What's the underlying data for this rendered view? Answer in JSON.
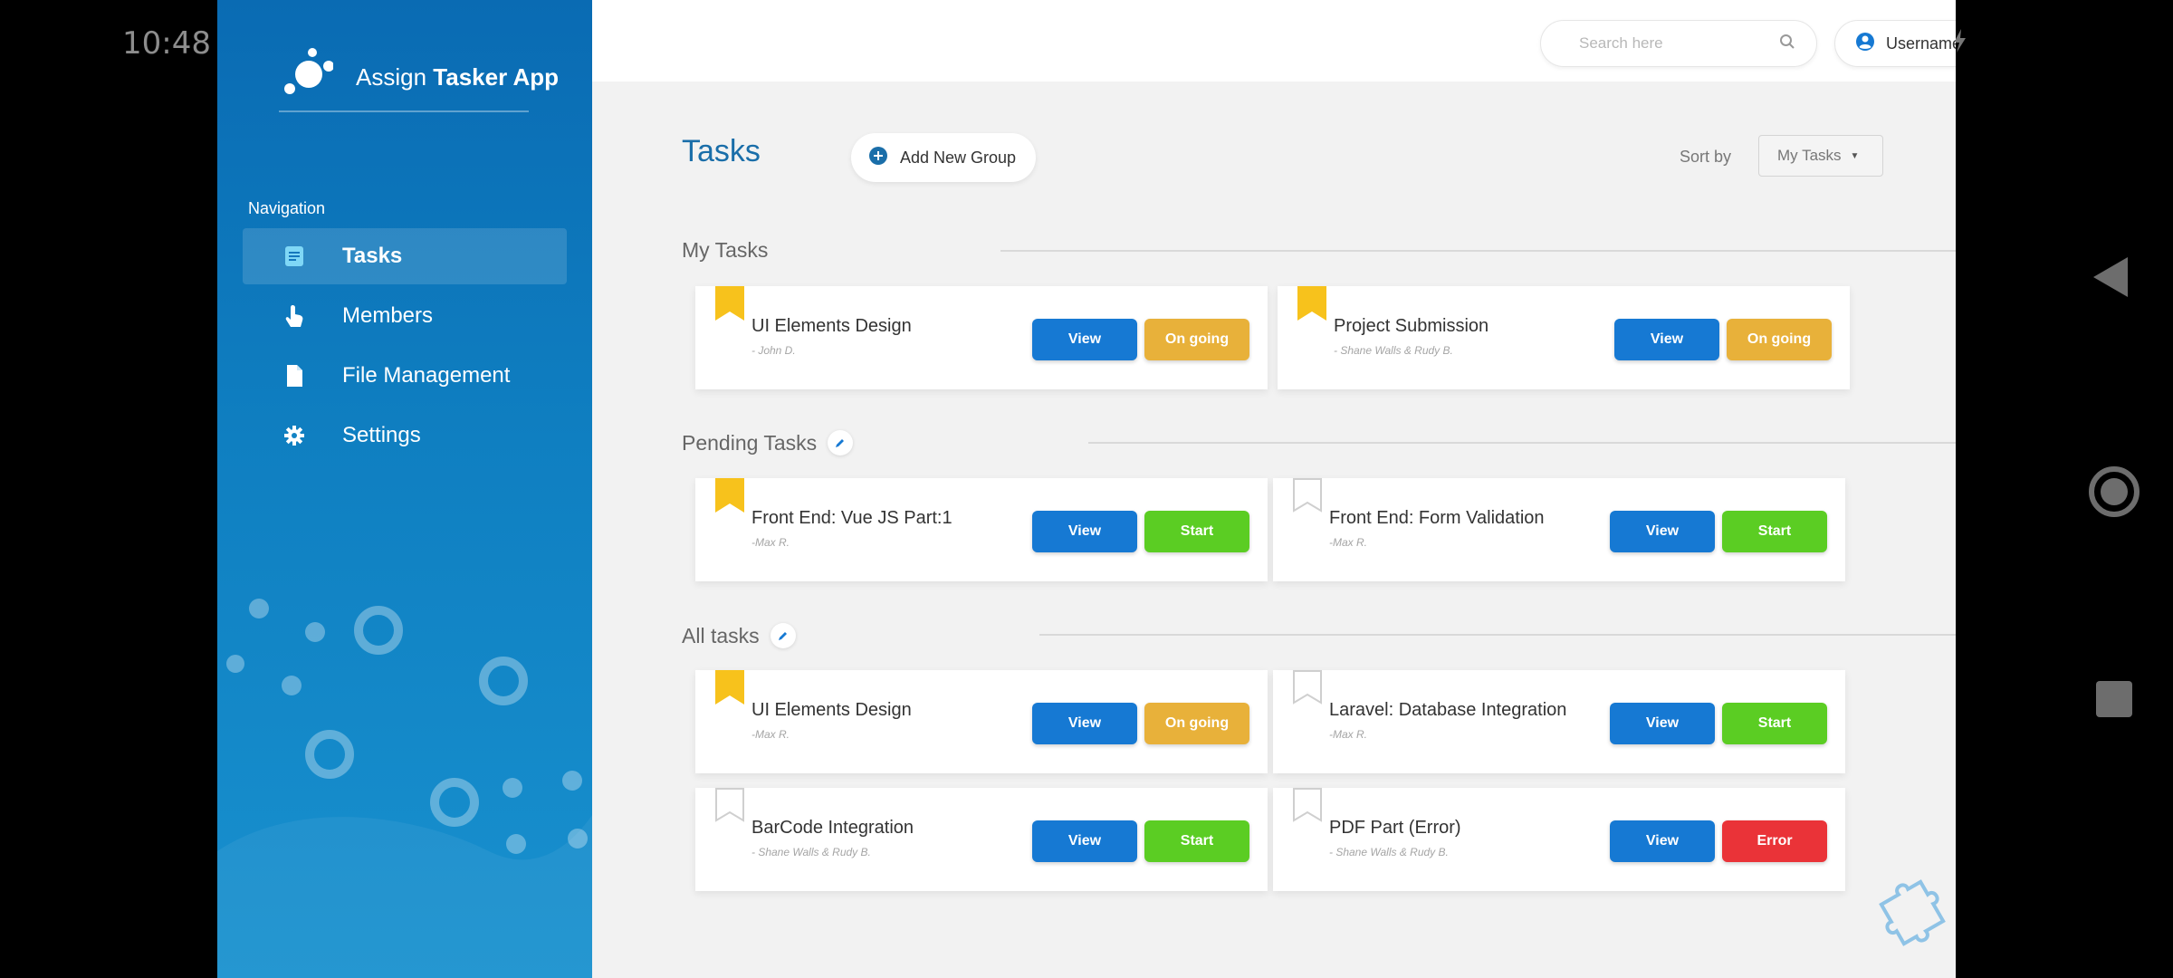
{
  "status_bar": {
    "time": "10:48"
  },
  "app": {
    "logo_prefix": "Assign",
    "logo_bold": "Tasker App"
  },
  "sidebar": {
    "caption": "Navigation",
    "items": [
      {
        "label": "Tasks",
        "icon": "tasks-icon",
        "active": true
      },
      {
        "label": "Members",
        "icon": "members-icon",
        "active": false
      },
      {
        "label": "File Management",
        "icon": "file-icon",
        "active": false
      },
      {
        "label": "Settings",
        "icon": "gear-icon",
        "active": false
      }
    ]
  },
  "topbar": {
    "search_placeholder": "Search here",
    "username": "Username"
  },
  "main": {
    "title": "Tasks",
    "add_group_label": "Add New Group",
    "sort_label": "Sort by",
    "sort_value": "My Tasks"
  },
  "sections": [
    {
      "title": "My Tasks"
    },
    {
      "title": "Pending Tasks"
    },
    {
      "title": "All tasks"
    }
  ],
  "cards": [
    {
      "title": "UI Elements Design",
      "assignee": "- John D.",
      "view": "View",
      "status": "On going",
      "bookmarked": true
    },
    {
      "title": "Project Submission",
      "assignee": "- Shane Walls & Rudy B.",
      "view": "View",
      "status": "On going",
      "bookmarked": true
    },
    {
      "title": "Front End: Vue JS Part:1",
      "assignee": "-Max R.",
      "view": "View",
      "status": "Start",
      "bookmarked": true
    },
    {
      "title": "Front End: Form Validation",
      "assignee": "-Max R.",
      "view": "View",
      "status": "Start",
      "bookmarked": false
    },
    {
      "title": "UI Elements Design",
      "assignee": "-Max R.",
      "view": "View",
      "status": "On going",
      "bookmarked": true
    },
    {
      "title": "Laravel: Database Integration",
      "assignee": "-Max R.",
      "view": "View",
      "status": "Start",
      "bookmarked": false
    },
    {
      "title": "BarCode Integration",
      "assignee": "- Shane Walls & Rudy B.",
      "view": "View",
      "status": "Start",
      "bookmarked": false
    },
    {
      "title": "PDF Part (Error)",
      "assignee": "- Shane Walls & Rudy B.",
      "view": "View",
      "status": "Error",
      "bookmarked": false
    }
  ],
  "colors": {
    "sidebar": "#0f7fc1",
    "view_button": "#1679d3",
    "ongoing": "#e8b13a",
    "start": "#5bcd23",
    "error": "#ea3338",
    "bookmark": "#f7c21c",
    "title": "#1a6ea9"
  }
}
